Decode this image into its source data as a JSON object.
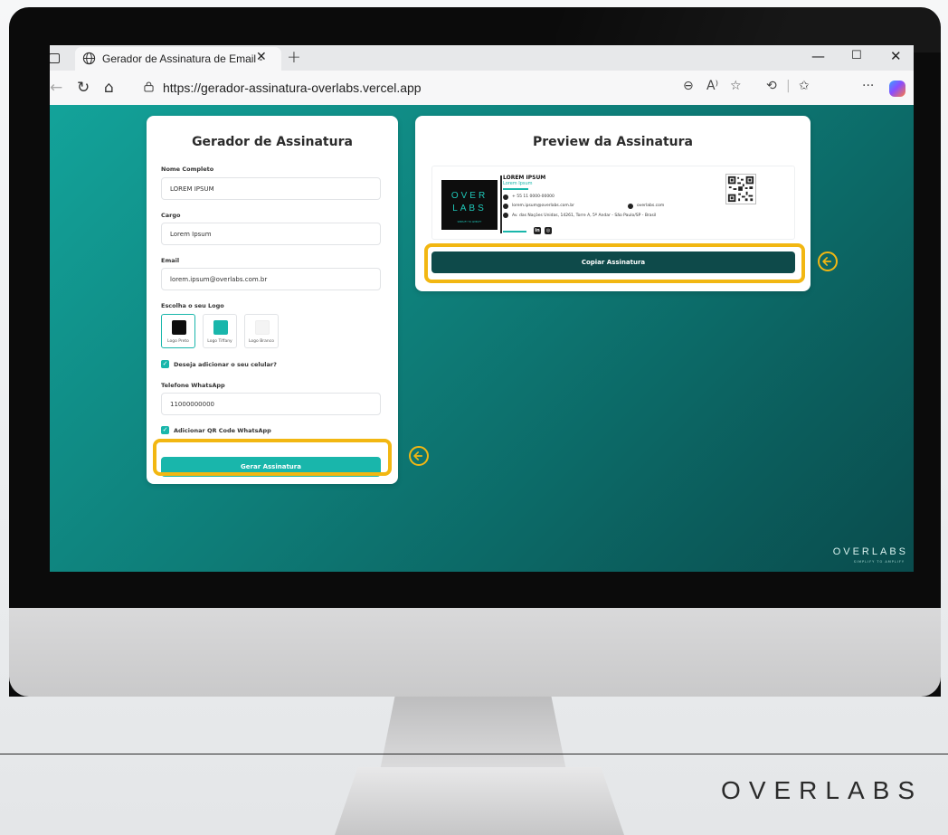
{
  "browser": {
    "tab_title": "Gerador de Assinatura de Email -",
    "url": "https://gerador-assinatura-overlabs.vercel.app",
    "reader_label": "A⁾"
  },
  "form": {
    "title": "Gerador de Assinatura",
    "name_label": "Nome Completo",
    "name_value": "LOREM IPSUM",
    "role_label": "Cargo",
    "role_value": "Lorem Ipsum",
    "email_label": "Email",
    "email_value": "lorem.ipsum@overlabs.com.br",
    "logo_label": "Escolha o seu Logo",
    "logos": [
      {
        "label": "Logo Preto",
        "color": "#0d0d0d"
      },
      {
        "label": "Logo Tiffany",
        "color": "#19b6ab"
      },
      {
        "label": "Logo Branco",
        "color": "#ffffff"
      }
    ],
    "add_phone_label": "Deseja adicionar o seu celular?",
    "phone_label": "Telefone WhatsApp",
    "phone_value": "11000000000",
    "add_qr_label": "Adicionar QR Code WhatsApp",
    "generate_button": "Gerar Assinatura"
  },
  "preview": {
    "title": "Preview da Assinatura",
    "logo_top": "OVER",
    "logo_bottom": "LABS",
    "logo_tagline": "SIMPLIFY TO AMPLIFY",
    "name": "LOREM IPSUM",
    "role": "Lorem Ipsum",
    "phone": "+ 55 11 0000-00000",
    "email": "lorem.ipsum@overlabs.com.br",
    "website": "overlabs.com",
    "address": "Av. das Nações Unidas, 14261, Torre A, 5º Andar - São Paulo/SP - Brasil",
    "copy_button": "Copiar Assinatura"
  },
  "page_brand": {
    "name": "OVERLABS",
    "tagline": "SIMPLIFY TO AMPLIFY"
  },
  "footer_brand": "OVERLABS",
  "colors": {
    "accent": "#19b6ab",
    "dark_button": "#0e4a4a",
    "highlight": "#f2b712"
  }
}
